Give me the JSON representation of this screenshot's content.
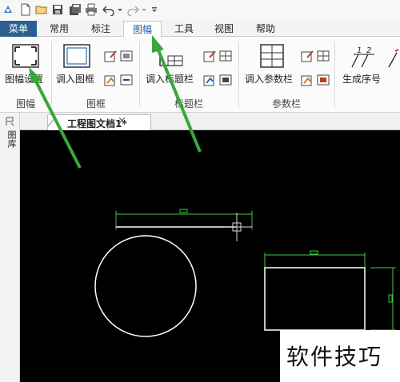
{
  "tabs": {
    "menu": "菜单",
    "common": "常用",
    "annotate": "标注",
    "frame": "图幅",
    "tools": "工具",
    "view": "视图",
    "help": "帮助"
  },
  "ribbon": {
    "frame_setup": "图幅设置",
    "insert_frame": "调入图框",
    "insert_titleblock": "调入标题栏",
    "insert_paramblock": "调入参数栏",
    "generate_serial": "生成序号",
    "group_frame_size": "图幅",
    "group_frame": "图框",
    "group_titleblock": "标题栏",
    "group_paramblock": "参数栏"
  },
  "document": {
    "tab_title": "工程图文档1*",
    "close_symbol": "×"
  },
  "side_panel": {
    "label": "图库"
  },
  "watermark": {
    "text": "软件技巧"
  },
  "colors": {
    "menu_tab_bg": "#2c5f8f",
    "active_tab_text": "#1a5aa8",
    "canvas_bg": "#000000",
    "annotation_arrow": "#3aa63a",
    "dimension_line": "#46c846",
    "geometry_line": "#ffffff"
  }
}
